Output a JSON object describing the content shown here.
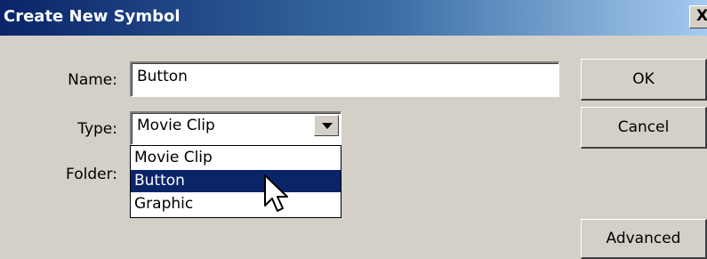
{
  "window": {
    "title": "Create New Symbol",
    "close_label": "X"
  },
  "form": {
    "name_label": "Name:",
    "name_value": "Button",
    "type_label": "Type:",
    "type_value": "Movie Clip",
    "folder_label": "Folder:"
  },
  "dropdown": {
    "options": [
      {
        "label": "Movie Clip",
        "selected": false
      },
      {
        "label": "Button",
        "selected": true
      },
      {
        "label": "Graphic",
        "selected": false
      }
    ]
  },
  "buttons": {
    "ok_label": "OK",
    "cancel_label": "Cancel",
    "advanced_label": "Advanced"
  },
  "colors": {
    "dialog_bg": "#d4d0c8",
    "titlebar_start": "#0a246a",
    "titlebar_end": "#a6caf0",
    "selection": "#0a246a"
  },
  "icons": {
    "close": "close-icon",
    "dropdown_arrow": "chevron-down-icon",
    "cursor": "mouse-pointer-icon"
  }
}
